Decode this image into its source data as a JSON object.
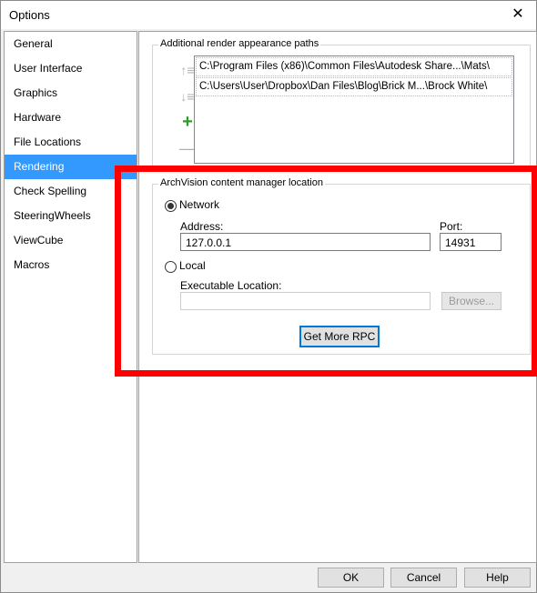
{
  "window": {
    "title": "Options"
  },
  "sidebar": {
    "items": [
      {
        "label": "General"
      },
      {
        "label": "User Interface"
      },
      {
        "label": "Graphics"
      },
      {
        "label": "Hardware"
      },
      {
        "label": "File Locations"
      },
      {
        "label": "Rendering",
        "selected": true
      },
      {
        "label": "Check Spelling"
      },
      {
        "label": "SteeringWheels"
      },
      {
        "label": "ViewCube"
      },
      {
        "label": "Macros"
      }
    ]
  },
  "render_paths": {
    "title": "Additional render appearance paths",
    "paths": [
      "C:\\Program Files (x86)\\Common Files\\Autodesk Share...\\Mats\\",
      "C:\\Users\\User\\Dropbox\\Dan Files\\Blog\\Brick M...\\Brock White\\"
    ],
    "tools": [
      "move-up-icon",
      "move-down-icon",
      "add-icon",
      "remove-icon"
    ]
  },
  "archvision": {
    "title": "ArchVision content manager location",
    "network_label": "Network",
    "network_selected": true,
    "address_label": "Address:",
    "address_value": "127.0.0.1",
    "port_label": "Port:",
    "port_value": "14931",
    "local_label": "Local",
    "exec_label": "Executable Location:",
    "exec_value": "",
    "browse_label": "Browse...",
    "get_more_label": "Get More RPC"
  },
  "footer": {
    "ok_label": "OK",
    "cancel_label": "Cancel",
    "help_label": "Help"
  },
  "colors": {
    "selection": "#3399ff",
    "highlight_box": "#ff0000",
    "add_icon": "#2d9b2d"
  }
}
